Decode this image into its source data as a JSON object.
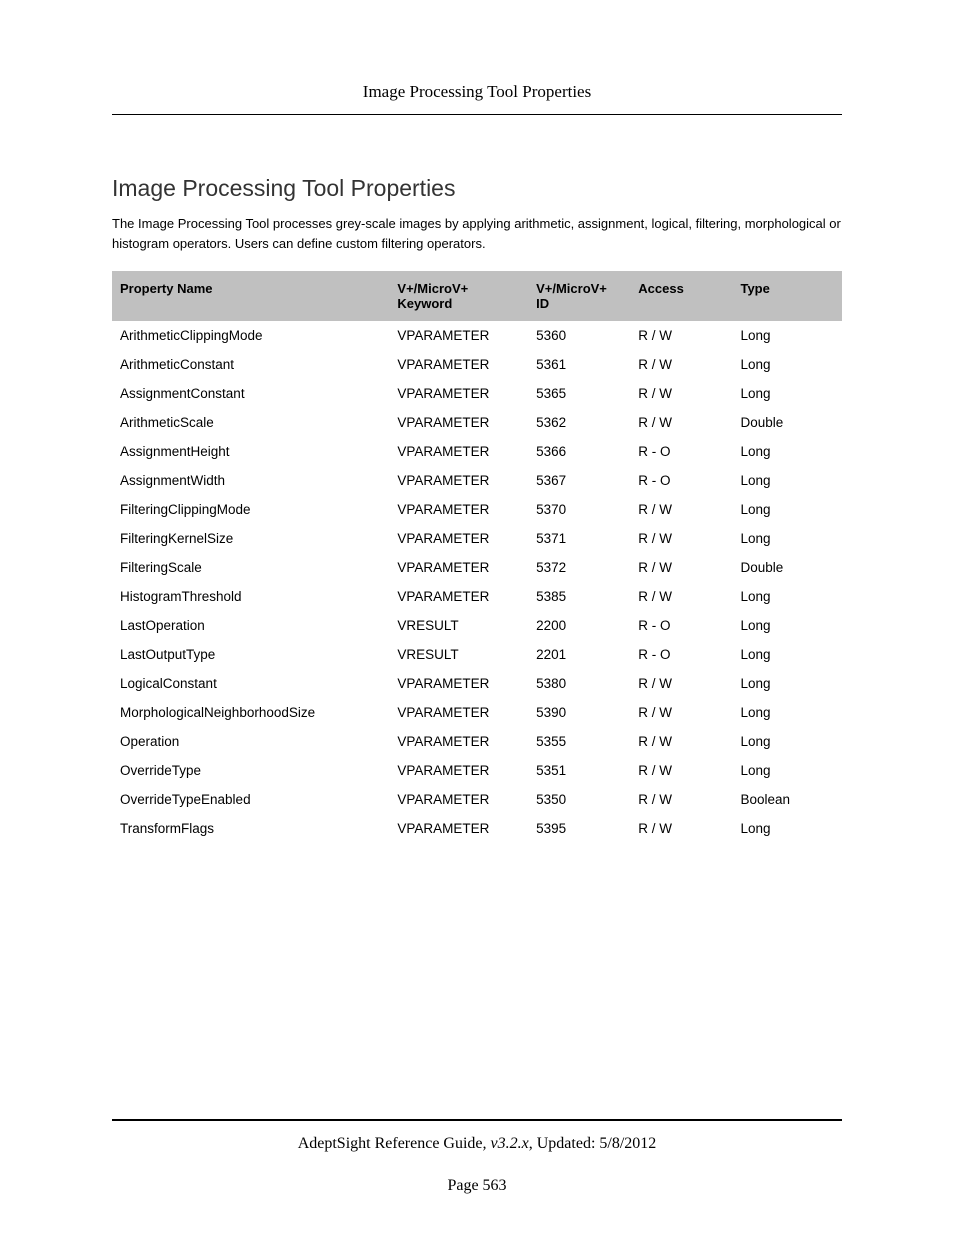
{
  "header": {
    "running_title": "Image Processing Tool Properties"
  },
  "section": {
    "title": "Image Processing Tool Properties",
    "intro": "The Image Processing Tool processes grey-scale images by applying arithmetic, assignment, logical, filtering, morphological or histogram operators. Users can define custom filtering operators."
  },
  "table": {
    "headers": {
      "name": "Property Name",
      "keyword": "V+/MicroV+ Keyword",
      "id": "V+/MicroV+ ID",
      "access": "Access",
      "type": "Type"
    },
    "rows": [
      {
        "name": "ArithmeticClippingMode",
        "keyword": "VPARAMETER",
        "id": "5360",
        "access": "R / W",
        "type": "Long"
      },
      {
        "name": "ArithmeticConstant",
        "keyword": "VPARAMETER",
        "id": "5361",
        "access": "R / W",
        "type": "Long"
      },
      {
        "name": "AssignmentConstant",
        "keyword": "VPARAMETER",
        "id": "5365",
        "access": "R / W",
        "type": "Long"
      },
      {
        "name": "ArithmeticScale",
        "keyword": "VPARAMETER",
        "id": "5362",
        "access": "R / W",
        "type": "Double"
      },
      {
        "name": "AssignmentHeight",
        "keyword": "VPARAMETER",
        "id": "5366",
        "access": "R - O",
        "type": "Long"
      },
      {
        "name": "AssignmentWidth",
        "keyword": "VPARAMETER",
        "id": "5367",
        "access": "R - O",
        "type": "Long"
      },
      {
        "name": "FilteringClippingMode",
        "keyword": "VPARAMETER",
        "id": "5370",
        "access": "R / W",
        "type": "Long"
      },
      {
        "name": "FilteringKernelSize",
        "keyword": "VPARAMETER",
        "id": "5371",
        "access": "R / W",
        "type": "Long"
      },
      {
        "name": "FilteringScale",
        "keyword": "VPARAMETER",
        "id": "5372",
        "access": "R / W",
        "type": "Double"
      },
      {
        "name": "HistogramThreshold",
        "keyword": "VPARAMETER",
        "id": "5385",
        "access": "R / W",
        "type": "Long"
      },
      {
        "name": "LastOperation",
        "keyword": "VRESULT",
        "id": "2200",
        "access": "R - O",
        "type": "Long"
      },
      {
        "name": "LastOutputType",
        "keyword": "VRESULT",
        "id": "2201",
        "access": "R - O",
        "type": "Long"
      },
      {
        "name": "LogicalConstant",
        "keyword": "VPARAMETER",
        "id": "5380",
        "access": "R / W",
        "type": "Long"
      },
      {
        "name": "MorphologicalNeighborhoodSize",
        "keyword": "VPARAMETER",
        "id": "5390",
        "access": "R / W",
        "type": "Long"
      },
      {
        "name": "Operation",
        "keyword": "VPARAMETER",
        "id": "5355",
        "access": "R / W",
        "type": "Long"
      },
      {
        "name": "OverrideType",
        "keyword": "VPARAMETER",
        "id": "5351",
        "access": "R / W",
        "type": "Long"
      },
      {
        "name": "OverrideTypeEnabled",
        "keyword": "VPARAMETER",
        "id": "5350",
        "access": "R / W",
        "type": "Boolean"
      },
      {
        "name": "TransformFlags",
        "keyword": "VPARAMETER",
        "id": "5395",
        "access": "R / W",
        "type": "Long"
      }
    ]
  },
  "footer": {
    "guide_name": "AdeptSight Reference Guide",
    "version_phrase": ", v3.2.x",
    "updated_phrase": ", Updated: 5/8/2012",
    "page_label": "Page 563"
  }
}
